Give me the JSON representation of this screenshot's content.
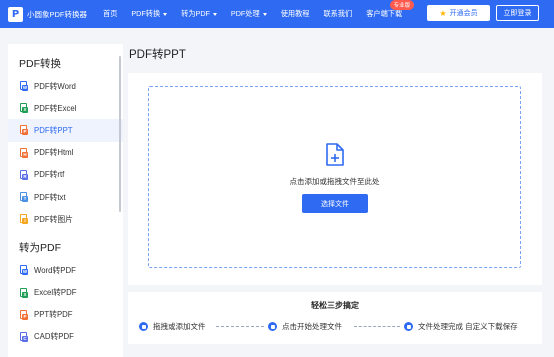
{
  "header": {
    "logo_letter": "P",
    "app_name": "小圆象PDF转换器",
    "nav": [
      {
        "label": "首页"
      },
      {
        "label": "PDF转换"
      },
      {
        "label": "转为PDF"
      },
      {
        "label": "PDF处理"
      },
      {
        "label": "使用教程"
      },
      {
        "label": "联系我们"
      },
      {
        "label": "客户端下载"
      }
    ],
    "pro_badge": "专业版",
    "vip_label": "开通会员",
    "login_label": "立即登录",
    "brand_color": "#2f6bf2"
  },
  "sidebar": {
    "section1_title": "PDF转换",
    "section1_items": [
      {
        "label": "PDF转Word",
        "icon": "word-icon",
        "color": "#2f6bf2",
        "tag": "W"
      },
      {
        "label": "PDF转Excel",
        "icon": "excel-icon",
        "color": "#1f9d55",
        "tag": "X"
      },
      {
        "label": "PDF转PPT",
        "icon": "ppt-icon",
        "color": "#f07036",
        "tag": "P"
      },
      {
        "label": "PDF转Html",
        "icon": "html-icon",
        "color": "#f07036",
        "tag": "H"
      },
      {
        "label": "PDF转rtf",
        "icon": "rtf-icon",
        "color": "#5b6ee8",
        "tag": "R"
      },
      {
        "label": "PDF转txt",
        "icon": "txt-icon",
        "color": "#4a90e2",
        "tag": "T"
      },
      {
        "label": "PDF转图片",
        "icon": "image-icon",
        "color": "#f5a623",
        "tag": "I"
      }
    ],
    "section2_title": "转为PDF",
    "section2_items": [
      {
        "label": "Word转PDF",
        "icon": "word-icon",
        "color": "#2f6bf2",
        "tag": "W"
      },
      {
        "label": "Excel转PDF",
        "icon": "excel-icon",
        "color": "#1f9d55",
        "tag": "X"
      },
      {
        "label": "PPT转PDF",
        "icon": "ppt-icon",
        "color": "#f07036",
        "tag": "P"
      },
      {
        "label": "CAD转PDF",
        "icon": "cad-icon",
        "color": "#5b6ee8",
        "tag": "C"
      }
    ]
  },
  "main": {
    "page_title": "PDF转PPT",
    "drop_text": "点击添加或拖拽文件至此处",
    "select_button": "选择文件"
  },
  "steps": {
    "title": "轻松三步搞定",
    "items": [
      {
        "label": "拖拽或添加文件"
      },
      {
        "label": "点击开始处理文件"
      },
      {
        "label": "文件处理完成 自定义下载保存"
      }
    ]
  }
}
